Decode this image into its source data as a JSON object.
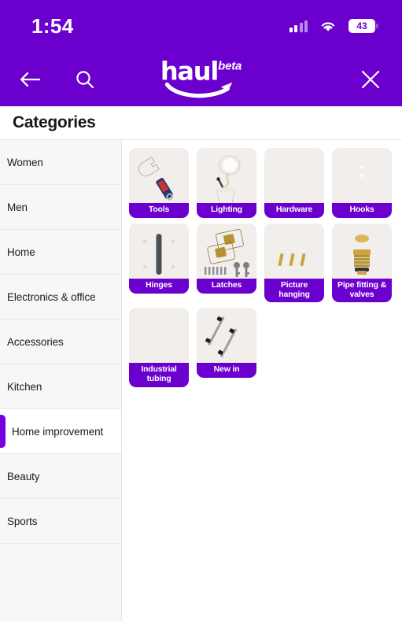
{
  "status_bar": {
    "time": "1:54",
    "battery_percent": "43",
    "cellular_icon": "cellular-signal-icon",
    "wifi_icon": "wifi-icon",
    "battery_icon": "battery-icon"
  },
  "nav": {
    "back_icon": "back-arrow-icon",
    "search_icon": "search-icon",
    "close_icon": "close-icon",
    "brand_word": "haul",
    "brand_badge": "beta",
    "brand_smile_icon": "amazon-smile-icon"
  },
  "page": {
    "title": "Categories"
  },
  "sidebar": {
    "items": [
      {
        "label": "Women",
        "active": false
      },
      {
        "label": "Men",
        "active": false
      },
      {
        "label": "Home",
        "active": false
      },
      {
        "label": "Electronics & office",
        "active": false
      },
      {
        "label": "Accessories",
        "active": false
      },
      {
        "label": "Kitchen",
        "active": false
      },
      {
        "label": "Home improvement",
        "active": true
      },
      {
        "label": "Beauty",
        "active": false
      },
      {
        "label": "Sports",
        "active": false
      }
    ]
  },
  "grid": {
    "tiles": [
      {
        "label": "Tools",
        "icon": "wrench-image",
        "lines": 1
      },
      {
        "label": "Lighting",
        "icon": "table-lamp-image",
        "lines": 1
      },
      {
        "label": "Hardware",
        "icon": "brass-t-pulls-image",
        "lines": 1
      },
      {
        "label": "Hooks",
        "icon": "black-double-hook-image",
        "lines": 1
      },
      {
        "label": "Hinges",
        "icon": "door-hinge-image",
        "lines": 1
      },
      {
        "label": "Latches",
        "icon": "brass-latches-image",
        "lines": 1
      },
      {
        "label": "Picture hanging",
        "icon": "picture-hooks-image",
        "lines": 2
      },
      {
        "label": "Pipe fitting & valves",
        "icon": "brass-valve-image",
        "lines": 2
      },
      {
        "label": "Industrial tubing",
        "icon": "coiled-tubing-image",
        "lines": 2
      },
      {
        "label": "New in",
        "icon": "black-bar-handles-image",
        "lines": 1
      }
    ]
  },
  "colors": {
    "brand_purple": "#6B00CE",
    "accent_purple": "#7700E0",
    "tile_bg": "#F1EEEC",
    "sidebar_bg": "#F7F7F7"
  }
}
